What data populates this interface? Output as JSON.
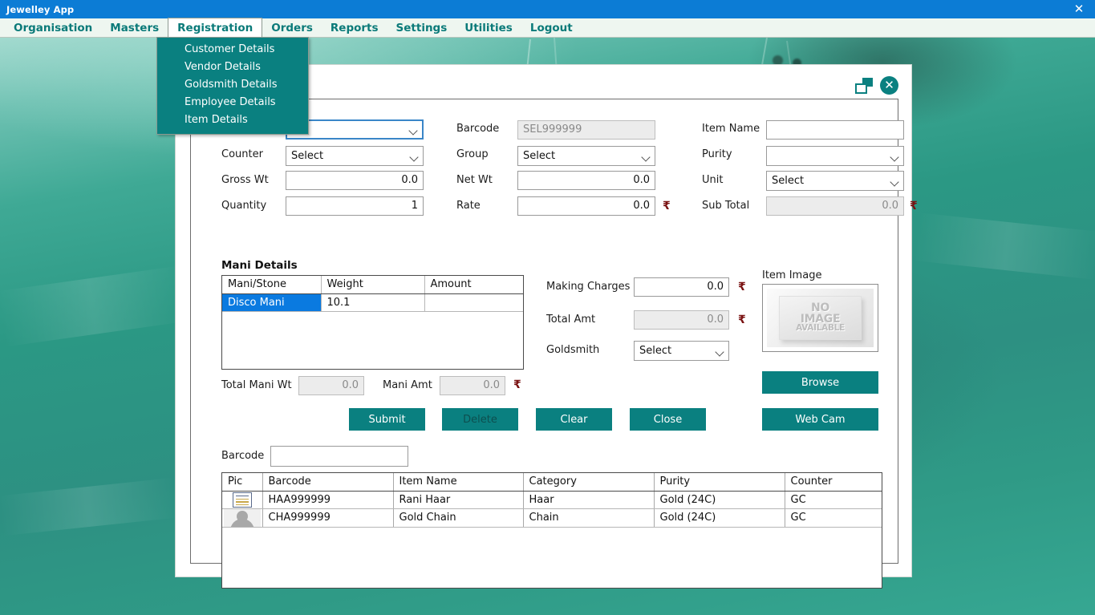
{
  "window": {
    "title": "Jewelley App",
    "close_label": "✕"
  },
  "menubar": {
    "items": [
      {
        "label": "Organisation",
        "active": false
      },
      {
        "label": "Masters",
        "active": false
      },
      {
        "label": "Registration",
        "active": true
      },
      {
        "label": "Orders",
        "active": false
      },
      {
        "label": "Reports",
        "active": false
      },
      {
        "label": "Settings",
        "active": false
      },
      {
        "label": "Utilities",
        "active": false
      },
      {
        "label": "Logout",
        "active": false
      }
    ]
  },
  "dropdown": {
    "items": [
      {
        "label": "Customer Details"
      },
      {
        "label": "Vendor Details"
      },
      {
        "label": "Goldsmith Details"
      },
      {
        "label": "Employee Details"
      },
      {
        "label": "Item Details"
      }
    ]
  },
  "dialog": {
    "restore_label": "",
    "close_label": "✕"
  },
  "form": {
    "row1": {
      "category_value": "",
      "barcode_label": "Barcode",
      "barcode_value": "SEL999999",
      "item_name_label": "Item Name",
      "item_name_value": ""
    },
    "counter_label": "Counter",
    "counter_value": "Select",
    "group_label": "Group",
    "group_value": "Select",
    "purity_label": "Purity",
    "purity_value": "",
    "gross_wt_label": "Gross Wt",
    "gross_wt_value": "0.0",
    "net_wt_label": "Net Wt",
    "net_wt_value": "0.0",
    "unit_label": "Unit",
    "unit_value": "Select",
    "quantity_label": "Quantity",
    "quantity_value": "1",
    "rate_label": "Rate",
    "rate_value": "0.0",
    "sub_total_label": "Sub Total",
    "sub_total_value": "0.0",
    "rupee": "₹"
  },
  "mani": {
    "section_title": "Mani Details",
    "columns": [
      "Mani/Stone",
      "Weight",
      "Amount"
    ],
    "rows": [
      {
        "stone": "Disco Mani",
        "weight": "10.1",
        "amount": "",
        "selected": true
      }
    ],
    "total_mani_wt_label": "Total Mani Wt",
    "total_mani_wt_value": "0.0",
    "mani_amt_label": "Mani Amt",
    "mani_amt_value": "0.0"
  },
  "charges": {
    "making_charges_label": "Making Charges",
    "making_charges_value": "0.0",
    "total_amt_label": "Total Amt",
    "total_amt_value": "0.0",
    "goldsmith_label": "Goldsmith",
    "goldsmith_value": "Select"
  },
  "item_image": {
    "title": "Item Image",
    "placeholder_line1": "NO",
    "placeholder_line2": "IMAGE",
    "placeholder_line3": "AVAILABLE",
    "browse_label": "Browse",
    "webcam_label": "Web Cam"
  },
  "actions": {
    "submit_label": "Submit",
    "delete_label": "Delete",
    "clear_label": "Clear",
    "close_label": "Close"
  },
  "search": {
    "barcode_label": "Barcode",
    "barcode_value": ""
  },
  "grid": {
    "columns": [
      "Pic",
      "Barcode",
      "Item Name",
      "Category",
      "Purity",
      "Counter"
    ],
    "rows": [
      {
        "pic": "document-icon",
        "barcode": "HAA999999",
        "item_name": "Rani Haar",
        "category": "Haar",
        "purity": "Gold (24C)",
        "counter": "GC"
      },
      {
        "pic": "person-icon",
        "barcode": "CHA999999",
        "item_name": "Gold Chain",
        "category": "Chain",
        "purity": "Gold (24C)",
        "counter": "GC"
      }
    ]
  },
  "colors": {
    "accent_teal": "#0a8080",
    "titlebar_blue": "#0c7cd5",
    "selection_blue": "#0a7ae0",
    "rupee_red": "#7a1212"
  }
}
